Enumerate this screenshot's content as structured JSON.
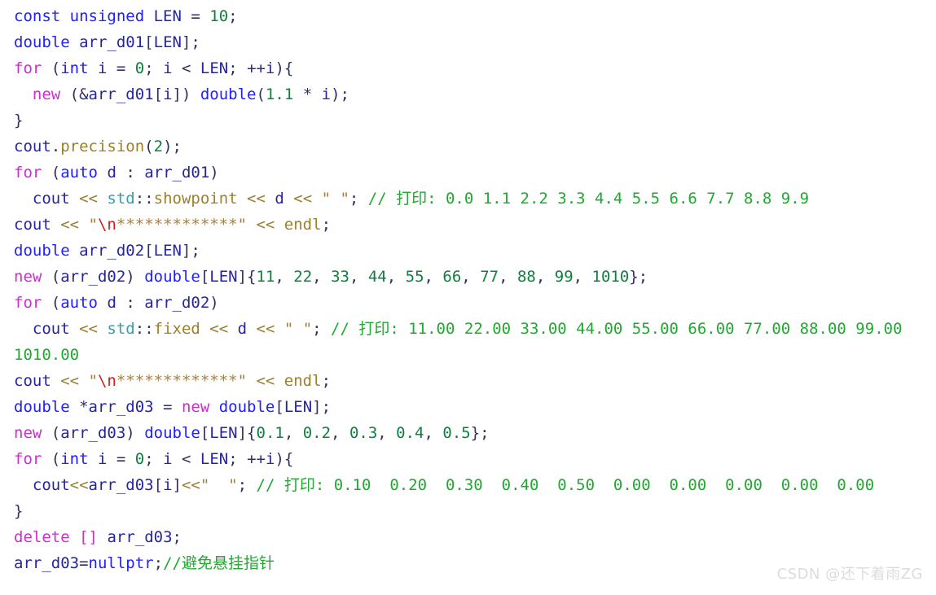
{
  "editor": {
    "language": "cpp",
    "background": "#ffffff",
    "font_size_px": 19,
    "line_height_px": 32,
    "palette": {
      "keyword": "#2020ff",
      "new_delete_keyword": "#cc2fcc",
      "identifier": "#25259e",
      "number": "#0f8040",
      "operator": "#9a7f2e",
      "string": "#a8803a",
      "escape": "#d02020",
      "comment": "#1faa2f",
      "namespace": "#3c9aaa",
      "punctuation": "#303060"
    }
  },
  "lines": [
    {
      "n": 1,
      "plain": "const unsigned LEN = 10;",
      "tokens": [
        {
          "t": "const unsigned",
          "c": "t-kw"
        },
        {
          "t": " ",
          "c": "t-punct"
        },
        {
          "t": "LEN",
          "c": "t-id"
        },
        {
          "t": " = ",
          "c": "t-punct"
        },
        {
          "t": "10",
          "c": "t-num"
        },
        {
          "t": ";",
          "c": "t-punct"
        }
      ]
    },
    {
      "n": 2,
      "plain": "double arr_d01[LEN];",
      "tokens": [
        {
          "t": "double",
          "c": "t-kw"
        },
        {
          "t": " ",
          "c": "t-punct"
        },
        {
          "t": "arr_d01",
          "c": "t-id"
        },
        {
          "t": "[",
          "c": "t-punct"
        },
        {
          "t": "LEN",
          "c": "t-id"
        },
        {
          "t": "];",
          "c": "t-punct"
        }
      ]
    },
    {
      "n": 3,
      "plain": "for (int i = 0; i < LEN; ++i){",
      "tokens": [
        {
          "t": "for",
          "c": "t-newkw"
        },
        {
          "t": " (",
          "c": "t-punct"
        },
        {
          "t": "int",
          "c": "t-kw"
        },
        {
          "t": " ",
          "c": "t-punct"
        },
        {
          "t": "i",
          "c": "t-id"
        },
        {
          "t": " = ",
          "c": "t-punct"
        },
        {
          "t": "0",
          "c": "t-num"
        },
        {
          "t": "; ",
          "c": "t-punct"
        },
        {
          "t": "i",
          "c": "t-id"
        },
        {
          "t": " < ",
          "c": "t-punct"
        },
        {
          "t": "LEN",
          "c": "t-id"
        },
        {
          "t": "; ++",
          "c": "t-punct"
        },
        {
          "t": "i",
          "c": "t-id"
        },
        {
          "t": "){",
          "c": "t-punct"
        }
      ]
    },
    {
      "n": 4,
      "plain": "  new (&arr_d01[i]) double(1.1 * i);",
      "tokens": [
        {
          "t": "  ",
          "c": "t-punct"
        },
        {
          "t": "new",
          "c": "t-newkw"
        },
        {
          "t": " (&",
          "c": "t-punct"
        },
        {
          "t": "arr_d01",
          "c": "t-id"
        },
        {
          "t": "[",
          "c": "t-punct"
        },
        {
          "t": "i",
          "c": "t-id"
        },
        {
          "t": "]) ",
          "c": "t-punct"
        },
        {
          "t": "double",
          "c": "t-kw"
        },
        {
          "t": "(",
          "c": "t-punct"
        },
        {
          "t": "1.1",
          "c": "t-num"
        },
        {
          "t": " * ",
          "c": "t-punct"
        },
        {
          "t": "i",
          "c": "t-id"
        },
        {
          "t": ");",
          "c": "t-punct"
        }
      ]
    },
    {
      "n": 5,
      "plain": "}",
      "tokens": [
        {
          "t": "}",
          "c": "t-punct"
        }
      ]
    },
    {
      "n": 6,
      "plain": "cout.precision(2);",
      "tokens": [
        {
          "t": "cout",
          "c": "t-id"
        },
        {
          "t": ".",
          "c": "t-punct"
        },
        {
          "t": "precision",
          "c": "t-op"
        },
        {
          "t": "(",
          "c": "t-punct"
        },
        {
          "t": "2",
          "c": "t-num"
        },
        {
          "t": ");",
          "c": "t-punct"
        }
      ]
    },
    {
      "n": 7,
      "plain": "for (auto d : arr_d01)",
      "tokens": [
        {
          "t": "for",
          "c": "t-newkw"
        },
        {
          "t": " (",
          "c": "t-punct"
        },
        {
          "t": "auto",
          "c": "t-kw"
        },
        {
          "t": " ",
          "c": "t-punct"
        },
        {
          "t": "d",
          "c": "t-id"
        },
        {
          "t": " : ",
          "c": "t-punct"
        },
        {
          "t": "arr_d01",
          "c": "t-id"
        },
        {
          "t": ")",
          "c": "t-punct"
        }
      ]
    },
    {
      "n": 8,
      "plain": "  cout << std::showpoint << d << \" \"; // 打印: 0.0 1.1 2.2 3.3 4.4 5.5 6.6 7.7 8.8 9.9",
      "tokens": [
        {
          "t": "  ",
          "c": "t-punct"
        },
        {
          "t": "cout",
          "c": "t-id"
        },
        {
          "t": " << ",
          "c": "t-op"
        },
        {
          "t": "std",
          "c": "t-ns"
        },
        {
          "t": "::",
          "c": "t-punct"
        },
        {
          "t": "showpoint",
          "c": "t-op"
        },
        {
          "t": " << ",
          "c": "t-op"
        },
        {
          "t": "d",
          "c": "t-id"
        },
        {
          "t": " << ",
          "c": "t-op"
        },
        {
          "t": "\" \"",
          "c": "t-str"
        },
        {
          "t": "; ",
          "c": "t-punct"
        },
        {
          "t": "// 打印: 0.0 1.1 2.2 3.3 4.4 5.5 6.6 7.7 8.8 9.9",
          "c": "t-cmt"
        }
      ]
    },
    {
      "n": 9,
      "plain": "cout << \"\\n*************\" << endl;",
      "tokens": [
        {
          "t": "cout",
          "c": "t-id"
        },
        {
          "t": " << ",
          "c": "t-op"
        },
        {
          "t": "\"",
          "c": "t-str"
        },
        {
          "t": "\\n",
          "c": "t-esc"
        },
        {
          "t": "*************\"",
          "c": "t-str"
        },
        {
          "t": " << ",
          "c": "t-op"
        },
        {
          "t": "endl",
          "c": "t-op"
        },
        {
          "t": ";",
          "c": "t-punct"
        }
      ]
    },
    {
      "n": 10,
      "plain": "double arr_d02[LEN];",
      "tokens": [
        {
          "t": "double",
          "c": "t-kw"
        },
        {
          "t": " ",
          "c": "t-punct"
        },
        {
          "t": "arr_d02",
          "c": "t-id"
        },
        {
          "t": "[",
          "c": "t-punct"
        },
        {
          "t": "LEN",
          "c": "t-id"
        },
        {
          "t": "];",
          "c": "t-punct"
        }
      ]
    },
    {
      "n": 11,
      "plain": "new (arr_d02) double[LEN]{11, 22, 33, 44, 55, 66, 77, 88, 99, 1010};",
      "tokens": [
        {
          "t": "new",
          "c": "t-newkw"
        },
        {
          "t": " (",
          "c": "t-punct"
        },
        {
          "t": "arr_d02",
          "c": "t-id"
        },
        {
          "t": ") ",
          "c": "t-punct"
        },
        {
          "t": "double",
          "c": "t-kw"
        },
        {
          "t": "[",
          "c": "t-punct"
        },
        {
          "t": "LEN",
          "c": "t-id"
        },
        {
          "t": "]{",
          "c": "t-punct"
        },
        {
          "t": "11",
          "c": "t-num"
        },
        {
          "t": ", ",
          "c": "t-punct"
        },
        {
          "t": "22",
          "c": "t-num"
        },
        {
          "t": ", ",
          "c": "t-punct"
        },
        {
          "t": "33",
          "c": "t-num"
        },
        {
          "t": ", ",
          "c": "t-punct"
        },
        {
          "t": "44",
          "c": "t-num"
        },
        {
          "t": ", ",
          "c": "t-punct"
        },
        {
          "t": "55",
          "c": "t-num"
        },
        {
          "t": ", ",
          "c": "t-punct"
        },
        {
          "t": "66",
          "c": "t-num"
        },
        {
          "t": ", ",
          "c": "t-punct"
        },
        {
          "t": "77",
          "c": "t-num"
        },
        {
          "t": ", ",
          "c": "t-punct"
        },
        {
          "t": "88",
          "c": "t-num"
        },
        {
          "t": ", ",
          "c": "t-punct"
        },
        {
          "t": "99",
          "c": "t-num"
        },
        {
          "t": ", ",
          "c": "t-punct"
        },
        {
          "t": "1010",
          "c": "t-num"
        },
        {
          "t": "};",
          "c": "t-punct"
        }
      ]
    },
    {
      "n": 12,
      "plain": "for (auto d : arr_d02)",
      "tokens": [
        {
          "t": "for",
          "c": "t-newkw"
        },
        {
          "t": " (",
          "c": "t-punct"
        },
        {
          "t": "auto",
          "c": "t-kw"
        },
        {
          "t": " ",
          "c": "t-punct"
        },
        {
          "t": "d",
          "c": "t-id"
        },
        {
          "t": " : ",
          "c": "t-punct"
        },
        {
          "t": "arr_d02",
          "c": "t-id"
        },
        {
          "t": ")",
          "c": "t-punct"
        }
      ]
    },
    {
      "n": 13,
      "plain": "  cout << std::fixed << d << \" \"; // 打印: 11.00 22.00 33.00 44.00 55.00 66.00 77.00 88.00 99.00",
      "tokens": [
        {
          "t": "  ",
          "c": "t-punct"
        },
        {
          "t": "cout",
          "c": "t-id"
        },
        {
          "t": " << ",
          "c": "t-op"
        },
        {
          "t": "std",
          "c": "t-ns"
        },
        {
          "t": "::",
          "c": "t-punct"
        },
        {
          "t": "fixed",
          "c": "t-op"
        },
        {
          "t": " << ",
          "c": "t-op"
        },
        {
          "t": "d",
          "c": "t-id"
        },
        {
          "t": " << ",
          "c": "t-op"
        },
        {
          "t": "\" \"",
          "c": "t-str"
        },
        {
          "t": "; ",
          "c": "t-punct"
        },
        {
          "t": "// 打印: 11.00 22.00 33.00 44.00 55.00 66.00 77.00 88.00 99.00",
          "c": "t-cmt"
        }
      ]
    },
    {
      "n": 14,
      "plain": "1010.00",
      "wrapped_continuation": true,
      "tokens": [
        {
          "t": "1010.00",
          "c": "t-cmt"
        }
      ]
    },
    {
      "n": 15,
      "plain": "cout << \"\\n*************\" << endl;",
      "tokens": [
        {
          "t": "cout",
          "c": "t-id"
        },
        {
          "t": " << ",
          "c": "t-op"
        },
        {
          "t": "\"",
          "c": "t-str"
        },
        {
          "t": "\\n",
          "c": "t-esc"
        },
        {
          "t": "*************\"",
          "c": "t-str"
        },
        {
          "t": " << ",
          "c": "t-op"
        },
        {
          "t": "endl",
          "c": "t-op"
        },
        {
          "t": ";",
          "c": "t-punct"
        }
      ]
    },
    {
      "n": 16,
      "plain": "double *arr_d03 = new double[LEN];",
      "tokens": [
        {
          "t": "double",
          "c": "t-kw"
        },
        {
          "t": " *",
          "c": "t-punct"
        },
        {
          "t": "arr_d03",
          "c": "t-id"
        },
        {
          "t": " = ",
          "c": "t-punct"
        },
        {
          "t": "new",
          "c": "t-newkw"
        },
        {
          "t": " ",
          "c": "t-punct"
        },
        {
          "t": "double",
          "c": "t-kw"
        },
        {
          "t": "[",
          "c": "t-punct"
        },
        {
          "t": "LEN",
          "c": "t-id"
        },
        {
          "t": "];",
          "c": "t-punct"
        }
      ]
    },
    {
      "n": 17,
      "plain": "new (arr_d03) double[LEN]{0.1, 0.2, 0.3, 0.4, 0.5};",
      "tokens": [
        {
          "t": "new",
          "c": "t-newkw"
        },
        {
          "t": " (",
          "c": "t-punct"
        },
        {
          "t": "arr_d03",
          "c": "t-id"
        },
        {
          "t": ") ",
          "c": "t-punct"
        },
        {
          "t": "double",
          "c": "t-kw"
        },
        {
          "t": "[",
          "c": "t-punct"
        },
        {
          "t": "LEN",
          "c": "t-id"
        },
        {
          "t": "]{",
          "c": "t-punct"
        },
        {
          "t": "0.1",
          "c": "t-num"
        },
        {
          "t": ", ",
          "c": "t-punct"
        },
        {
          "t": "0.2",
          "c": "t-num"
        },
        {
          "t": ", ",
          "c": "t-punct"
        },
        {
          "t": "0.3",
          "c": "t-num"
        },
        {
          "t": ", ",
          "c": "t-punct"
        },
        {
          "t": "0.4",
          "c": "t-num"
        },
        {
          "t": ", ",
          "c": "t-punct"
        },
        {
          "t": "0.5",
          "c": "t-num"
        },
        {
          "t": "};",
          "c": "t-punct"
        }
      ]
    },
    {
      "n": 18,
      "plain": "for (int i = 0; i < LEN; ++i){",
      "tokens": [
        {
          "t": "for",
          "c": "t-newkw"
        },
        {
          "t": " (",
          "c": "t-punct"
        },
        {
          "t": "int",
          "c": "t-kw"
        },
        {
          "t": " ",
          "c": "t-punct"
        },
        {
          "t": "i",
          "c": "t-id"
        },
        {
          "t": " = ",
          "c": "t-punct"
        },
        {
          "t": "0",
          "c": "t-num"
        },
        {
          "t": "; ",
          "c": "t-punct"
        },
        {
          "t": "i",
          "c": "t-id"
        },
        {
          "t": " < ",
          "c": "t-punct"
        },
        {
          "t": "LEN",
          "c": "t-id"
        },
        {
          "t": "; ++",
          "c": "t-punct"
        },
        {
          "t": "i",
          "c": "t-id"
        },
        {
          "t": "){",
          "c": "t-punct"
        }
      ]
    },
    {
      "n": 19,
      "plain": "  cout<<arr_d03[i]<<\"  \"; // 打印: 0.10  0.20  0.30  0.40  0.50  0.00  0.00  0.00  0.00  0.00",
      "tokens": [
        {
          "t": "  ",
          "c": "t-punct"
        },
        {
          "t": "cout",
          "c": "t-id"
        },
        {
          "t": "<<",
          "c": "t-op"
        },
        {
          "t": "arr_d03",
          "c": "t-id"
        },
        {
          "t": "[",
          "c": "t-punct"
        },
        {
          "t": "i",
          "c": "t-id"
        },
        {
          "t": "]",
          "c": "t-punct"
        },
        {
          "t": "<<",
          "c": "t-op"
        },
        {
          "t": "\"  \"",
          "c": "t-str"
        },
        {
          "t": "; ",
          "c": "t-punct"
        },
        {
          "t": "// 打印: 0.10  0.20  0.30  0.40  0.50  0.00  0.00  0.00  0.00  0.00",
          "c": "t-cmt"
        }
      ]
    },
    {
      "n": 20,
      "plain": "}",
      "tokens": [
        {
          "t": "}",
          "c": "t-punct"
        }
      ]
    },
    {
      "n": 21,
      "plain": "delete [] arr_d03;",
      "tokens": [
        {
          "t": "delete",
          "c": "t-newkw"
        },
        {
          "t": " ",
          "c": "t-punct"
        },
        {
          "t": "[]",
          "c": "t-newkw"
        },
        {
          "t": " ",
          "c": "t-punct"
        },
        {
          "t": "arr_d03",
          "c": "t-id"
        },
        {
          "t": ";",
          "c": "t-punct"
        }
      ]
    },
    {
      "n": 22,
      "plain": "arr_d03=nullptr;//避免悬挂指针",
      "tokens": [
        {
          "t": "arr_d03",
          "c": "t-id"
        },
        {
          "t": "=",
          "c": "t-punct"
        },
        {
          "t": "nullptr",
          "c": "t-kw"
        },
        {
          "t": ";",
          "c": "t-punct"
        },
        {
          "t": "//避免悬挂指针",
          "c": "t-cmt"
        }
      ]
    }
  ],
  "watermark": {
    "text": "CSDN @还下着雨ZG",
    "color": "#dcdcdc"
  }
}
